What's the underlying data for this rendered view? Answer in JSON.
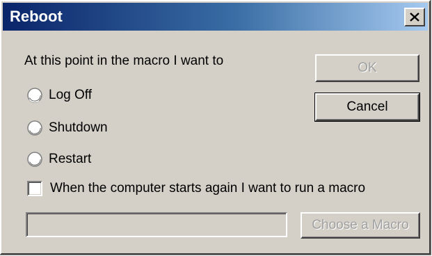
{
  "window": {
    "title": "Reboot",
    "close_symbol": "×"
  },
  "prompt": "At this point in the macro I want to",
  "options": [
    {
      "label": "Log Off",
      "selected": false
    },
    {
      "label": "Shutdown",
      "selected": false
    },
    {
      "label": "Restart",
      "selected": false
    }
  ],
  "run_macro": {
    "label": "When the computer starts again I want to run a macro",
    "checked": false
  },
  "macro_path": {
    "value": "",
    "enabled": false
  },
  "buttons": {
    "ok": "OK",
    "cancel": "Cancel",
    "choose_macro": "Choose a Macro"
  },
  "icons": {
    "close": "close-icon"
  },
  "colors": {
    "titlebar_start": "#0a246a",
    "titlebar_end": "#a6caf0",
    "dialog_face": "#d4d0c8",
    "disabled_text": "#a0a0a0"
  }
}
